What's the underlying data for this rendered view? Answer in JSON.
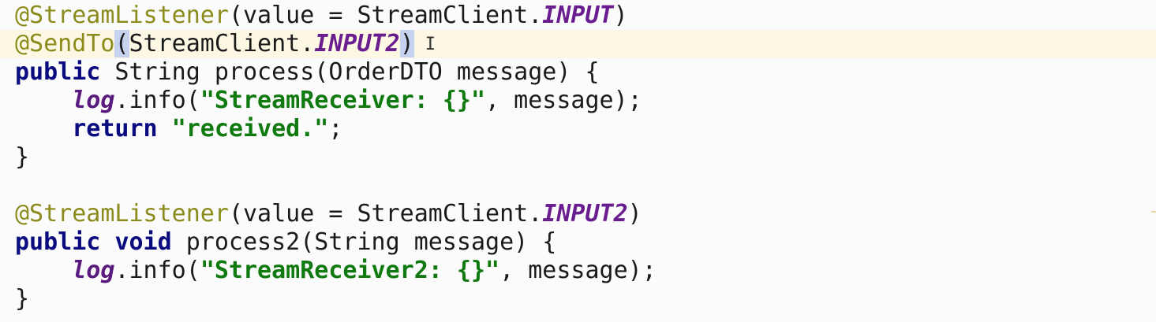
{
  "code": {
    "line1": {
      "annotation": "@StreamListener",
      "pre": "(value = StreamClient.",
      "constant": "INPUT",
      "post": ")"
    },
    "line2": {
      "annotation": "@SendTo",
      "open_paren": "(",
      "pre": "StreamClient.",
      "constant": "INPUT2",
      "close_paren": ")",
      "cursor": "I"
    },
    "line3": {
      "kw": "public",
      "rest": " String process(OrderDTO message) {"
    },
    "line4": {
      "indent": "    ",
      "field": "log",
      "pre": ".info(",
      "string": "\"StreamReceiver: {}\"",
      "post": ", message);"
    },
    "line5": {
      "indent": "    ",
      "kw": "return",
      "space": " ",
      "string": "\"received.\"",
      "post": ";"
    },
    "line6": {
      "text": "}"
    },
    "line7": {
      "annotation": "@StreamListener",
      "pre": "(value = StreamClient.",
      "constant": "INPUT2",
      "post": ")"
    },
    "line8": {
      "kw1": "public",
      "space1": " ",
      "kw2": "void",
      "rest": " process2(String message) {"
    },
    "line9": {
      "indent": "    ",
      "field": "log",
      "pre": ".info(",
      "string": "\"StreamReceiver2: {}\"",
      "post": ", message);"
    },
    "line10": {
      "text": "}"
    }
  }
}
